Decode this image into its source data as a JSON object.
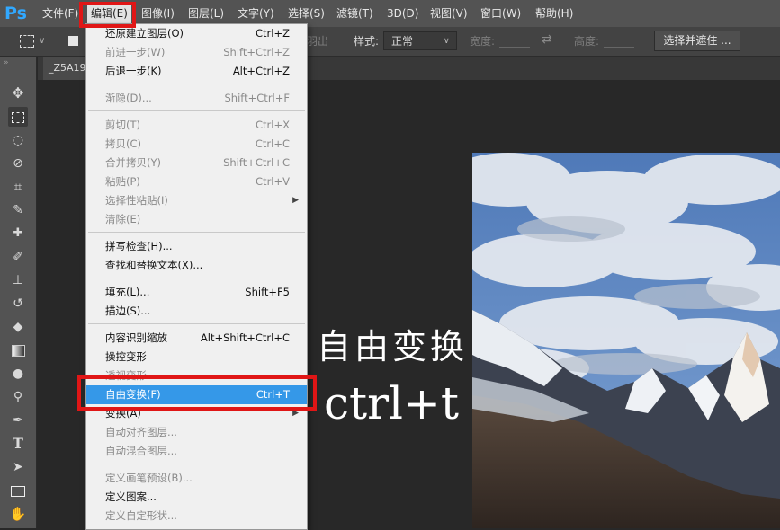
{
  "app": {
    "logo": "Ps",
    "accent": "#31a8ff"
  },
  "menubar": {
    "items": [
      "文件(F)",
      "编辑(E)",
      "图像(I)",
      "图层(L)",
      "文字(Y)",
      "选择(S)",
      "滤镜(T)",
      "3D(D)",
      "视图(V)",
      "窗口(W)",
      "帮助(H)"
    ]
  },
  "options_bar": {
    "feather_fragment": "羽出",
    "style_label": "样式:",
    "style_value": "正常",
    "width_label": "宽度:",
    "height_label": "高度:",
    "select_mask_button": "选择并遮住 ..."
  },
  "document": {
    "tab_title": "_Z5A19"
  },
  "edit_menu": {
    "items": [
      {
        "label": "还原建立图层(O)",
        "shortcut": "Ctrl+Z",
        "disabled": false
      },
      {
        "label": "前进一步(W)",
        "shortcut": "Shift+Ctrl+Z",
        "disabled": true
      },
      {
        "label": "后退一步(K)",
        "shortcut": "Alt+Ctrl+Z",
        "disabled": false
      },
      {
        "label": "渐隐(D)...",
        "shortcut": "Shift+Ctrl+F",
        "disabled": true
      },
      {
        "label": "剪切(T)",
        "shortcut": "Ctrl+X",
        "disabled": true
      },
      {
        "label": "拷贝(C)",
        "shortcut": "Ctrl+C",
        "disabled": true
      },
      {
        "label": "合并拷贝(Y)",
        "shortcut": "Shift+Ctrl+C",
        "disabled": true
      },
      {
        "label": "粘贴(P)",
        "shortcut": "Ctrl+V",
        "disabled": true
      },
      {
        "label": "选择性粘贴(I)",
        "shortcut": "",
        "disabled": true,
        "submenu": true
      },
      {
        "label": "清除(E)",
        "shortcut": "",
        "disabled": true
      },
      {
        "label": "拼写检查(H)...",
        "shortcut": "",
        "disabled": false
      },
      {
        "label": "查找和替换文本(X)...",
        "shortcut": "",
        "disabled": false
      },
      {
        "label": "填充(L)...",
        "shortcut": "Shift+F5",
        "disabled": false
      },
      {
        "label": "描边(S)...",
        "shortcut": "",
        "disabled": false
      },
      {
        "label": "内容识别缩放",
        "shortcut": "Alt+Shift+Ctrl+C",
        "disabled": false
      },
      {
        "label": "操控变形",
        "shortcut": "",
        "disabled": false
      },
      {
        "label": "透视变形",
        "shortcut": "",
        "disabled": true
      },
      {
        "label": "自由变换(F)",
        "shortcut": "Ctrl+T",
        "disabled": false,
        "highlighted": true
      },
      {
        "label": "变换(A)",
        "shortcut": "",
        "disabled": false,
        "submenu": true
      },
      {
        "label": "自动对齐图层...",
        "shortcut": "",
        "disabled": true
      },
      {
        "label": "自动混合图层...",
        "shortcut": "",
        "disabled": true
      },
      {
        "label": "定义画笔预设(B)...",
        "shortcut": "",
        "disabled": true
      },
      {
        "label": "定义图案...",
        "shortcut": "",
        "disabled": false
      },
      {
        "label": "定义自定形状...",
        "shortcut": "",
        "disabled": true
      }
    ]
  },
  "annotation": {
    "title": "自由变换",
    "shortcut": "ctrl+t",
    "highlight_color": "#e01616"
  },
  "tools": [
    "move-icon",
    "marquee-icon",
    "lasso-icon",
    "quick-select-icon",
    "crop-icon",
    "eyedropper-icon",
    "healing-icon",
    "brush-icon",
    "stamp-icon",
    "history-brush-icon",
    "eraser-icon",
    "gradient-icon",
    "blur-icon",
    "dodge-icon",
    "pen-icon",
    "type-icon",
    "path-select-icon",
    "rectangle-icon",
    "hand-icon"
  ]
}
